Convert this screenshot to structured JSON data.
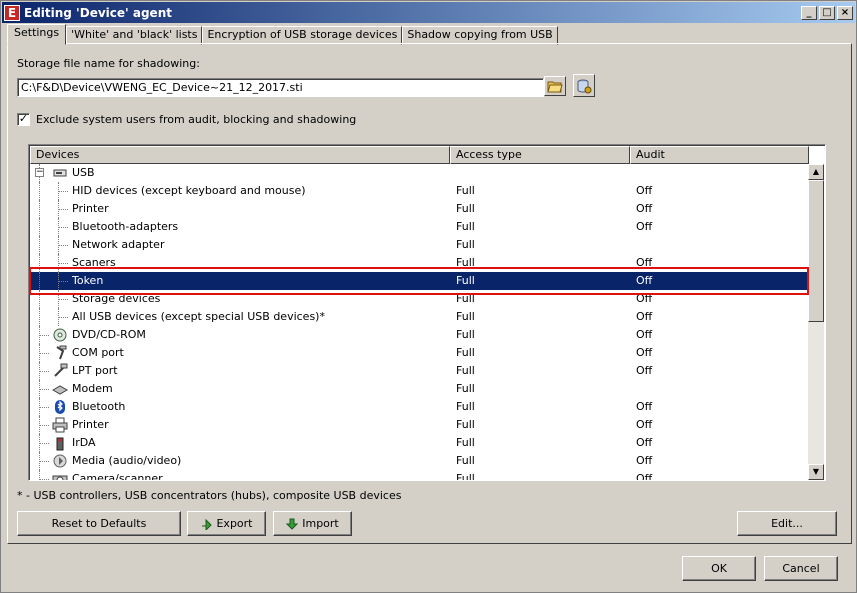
{
  "window": {
    "title": "Editing 'Device' agent",
    "app_icon_letter": "E"
  },
  "tabs": [
    {
      "label": "Settings",
      "active": true
    },
    {
      "label": "'White' and 'black' lists",
      "active": false
    },
    {
      "label": "Encryption of USB storage devices",
      "active": false
    },
    {
      "label": "Shadow copying from USB",
      "active": false
    }
  ],
  "storage": {
    "label": "Storage file name for shadowing:",
    "value": "C:\\F&D\\Device\\VWENG_EC_Device~21_12_2017.sti"
  },
  "exclude_checkbox": {
    "label": "Exclude system users from audit, blocking and shadowing",
    "checked": true
  },
  "list": {
    "headers": {
      "devices": "Devices",
      "access": "Access type",
      "audit": "Audit"
    },
    "rows": [
      {
        "name": "USB",
        "access": "",
        "audit": "",
        "level": 0,
        "icon": "usb-icon",
        "expander": "−"
      },
      {
        "name": "HID devices (except keyboard and mouse)",
        "access": "Full",
        "audit": "Off",
        "level": 1
      },
      {
        "name": "Printer",
        "access": "Full",
        "audit": "Off",
        "level": 1
      },
      {
        "name": "Bluetooth-adapters",
        "access": "Full",
        "audit": "Off",
        "level": 1
      },
      {
        "name": "Network adapter",
        "access": "Full",
        "audit": "",
        "level": 1
      },
      {
        "name": "Scaners",
        "access": "Full",
        "audit": "Off",
        "level": 1
      },
      {
        "name": "Token",
        "access": "Full",
        "audit": "Off",
        "level": 1,
        "selected": true
      },
      {
        "name": "Storage devices",
        "access": "Full",
        "audit": "Off",
        "level": 1
      },
      {
        "name": "All USB devices (except special USB devices)*",
        "access": "Full",
        "audit": "Off",
        "level": 1
      },
      {
        "name": "DVD/CD-ROM",
        "access": "Full",
        "audit": "Off",
        "level": 0,
        "icon": "cdrom-icon"
      },
      {
        "name": "COM port",
        "access": "Full",
        "audit": "Off",
        "level": 0,
        "icon": "com-port-icon"
      },
      {
        "name": "LPT port",
        "access": "Full",
        "audit": "Off",
        "level": 0,
        "icon": "lpt-port-icon"
      },
      {
        "name": "Modem",
        "access": "Full",
        "audit": "",
        "level": 0,
        "icon": "modem-icon"
      },
      {
        "name": "Bluetooth",
        "access": "Full",
        "audit": "Off",
        "level": 0,
        "icon": "bluetooth-icon"
      },
      {
        "name": "Printer",
        "access": "Full",
        "audit": "Off",
        "level": 0,
        "icon": "printer-icon"
      },
      {
        "name": "IrDA",
        "access": "Full",
        "audit": "Off",
        "level": 0,
        "icon": "irda-icon"
      },
      {
        "name": "Media (audio/video)",
        "access": "Full",
        "audit": "Off",
        "level": 0,
        "icon": "media-icon"
      },
      {
        "name": "Camera/scanner",
        "access": "Full",
        "audit": "Off",
        "level": 0,
        "icon": "camera-icon"
      }
    ]
  },
  "footnote": "* - USB controllers, USB concentrators (hubs), composite USB devices",
  "buttons": {
    "reset": "Reset to Defaults",
    "export": "Export",
    "import": "Import",
    "edit": "Edit...",
    "ok": "OK",
    "cancel": "Cancel"
  },
  "colors": {
    "selection": "#0a246a",
    "highlight_box": "#e01010",
    "face": "#d4d0c8"
  }
}
